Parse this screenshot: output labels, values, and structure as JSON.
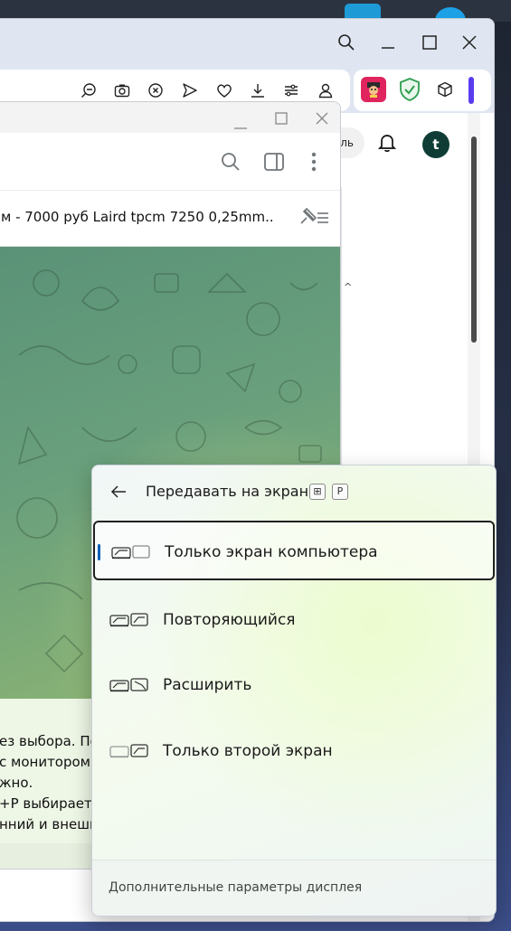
{
  "browser": {
    "toolbar_icons": [
      "zoom-out-icon",
      "camera-icon",
      "shield-x-icon",
      "send-icon",
      "heart-icon",
      "download-icon",
      "sliders-icon",
      "user-icon"
    ],
    "extensions": [
      "cartoon-extension-icon",
      "shield-check-icon",
      "cube-icon"
    ],
    "page": {
      "partial_text": "ль",
      "avatar_letter": "t",
      "avatar_color": "#0f3d36"
    }
  },
  "telegram": {
    "pinned_text": "м - 7000 руб  Laird tpcm 7250 0,25mm...",
    "message_lines": [
      "ез выбора. Пе",
      "с монитором",
      "жно.",
      "+P   выбирает",
      "нний и внешн"
    ]
  },
  "flyout": {
    "title": "Передавать на экран",
    "shortcut_win": "⊞",
    "shortcut_key": "P",
    "options": [
      {
        "label": "Только экран компьютера",
        "selected": true
      },
      {
        "label": "Повторяющийся",
        "selected": false
      },
      {
        "label": "Расширить",
        "selected": false
      },
      {
        "label": "Только второй экран",
        "selected": false
      }
    ],
    "footer_link": "Дополнительные параметры дисплея"
  },
  "colors": {
    "accent": "#005fb8",
    "chat_green": "#6aa07c",
    "titlebar": "#dfe6f1"
  }
}
